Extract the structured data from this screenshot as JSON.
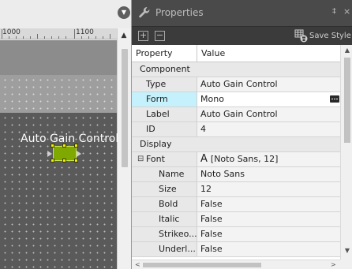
{
  "canvas": {
    "ruler_labels": [
      "1000",
      "1100"
    ],
    "component_label": "Auto Gain Control"
  },
  "panel": {
    "title": "Properties",
    "pin_glyph": "‡",
    "close_glyph": "×",
    "collapse_glyph": "▼"
  },
  "toolbar": {
    "expand_all": "+",
    "collapse_all": "−",
    "save_style_label": "Save Style"
  },
  "table": {
    "headers": {
      "property": "Property",
      "value": "Value"
    },
    "categories": {
      "component": "Component",
      "display": "Display"
    },
    "rows": {
      "type": {
        "name": "Type",
        "value": "Auto Gain Control"
      },
      "form": {
        "name": "Form",
        "value": "Mono"
      },
      "label": {
        "name": "Label",
        "value": "Auto Gain Control"
      },
      "id": {
        "name": "ID",
        "value": "4"
      },
      "font": {
        "expander": "⊟",
        "name": "Font",
        "glyph": "A",
        "value": "[Noto Sans, 12]"
      },
      "font_name": {
        "name": "Name",
        "value": "Noto Sans"
      },
      "font_size": {
        "name": "Size",
        "value": "12"
      },
      "font_bold": {
        "name": "Bold",
        "value": "False"
      },
      "font_italic": {
        "name": "Italic",
        "value": "False"
      },
      "font_strikeout": {
        "name": "Strikeo...",
        "value": "False"
      },
      "font_underline": {
        "name": "Underl...",
        "value": "False"
      }
    },
    "selected_row": "Form"
  },
  "scroll": {
    "up": "▲",
    "down": "▼",
    "left": "<",
    "right": ">"
  },
  "colors": {
    "selected_row": "#c4f1fb",
    "component_fill": "#7fa800",
    "handle": "#f3f300"
  }
}
